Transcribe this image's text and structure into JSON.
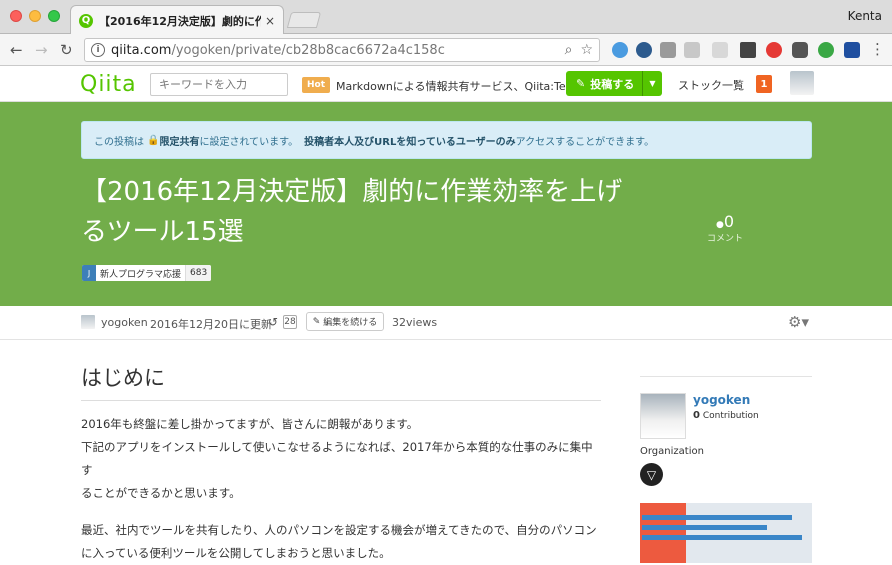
{
  "browser": {
    "tab_title": "【2016年12月決定版】劇的に作業",
    "tab_close": "×",
    "profile": "Kenta",
    "url_host": "qiita.com",
    "url_path": "/yogoken/private/cb28b8cac6672a4c158c"
  },
  "header": {
    "logo": "Qiita",
    "search_placeholder": "キーワードを入力",
    "hot_badge": "Hot",
    "hot_text": "Markdownによる情報共有サービス、Qiita:Team",
    "post_button": "投稿する",
    "stock_link": "ストック一覧",
    "notifications": "1"
  },
  "notice": {
    "pre": "この投稿は",
    "lock_scope": "限定共有",
    "mid": "に設定されています。",
    "emph": "投稿者本人及びURLを知っているユーザーのみ",
    "post": "アクセスすることができます。"
  },
  "article": {
    "title": "【2016年12月決定版】劇的に作業効率を上げるツール15選",
    "comment_count": "0",
    "comment_label": "コメント",
    "tag_name": "新人プログラマ応援",
    "tag_count": "683"
  },
  "meta": {
    "author": "yogoken",
    "updated": "2016年12月20日に更新",
    "revisions": "28",
    "edit_button": "編集を続ける",
    "views": "32views"
  },
  "body": {
    "heading": "はじめに",
    "para1_line1": "2016年も終盤に差し掛かってますが、皆さんに朗報があります。",
    "para1_line2": "下記のアプリをインストールして使いこなせるようになれば、2017年から本質的な仕事のみに集中す",
    "para1_line3": "ることができるかと思います。",
    "para2_line1": "最近、社内でツールを共有したり、人のパソコンを設定する機会が増えてきたので、自分のパソコン",
    "para2_line2": "に入っている便利ツールを公開してしまおうと思いました。"
  },
  "sidebar": {
    "username": "yogoken",
    "contribution_count": "0",
    "contribution_label": "Contribution",
    "organization_label": "Organization"
  },
  "colors": {
    "qiita_green": "#55c500",
    "hero_green": "#72ad4a",
    "notice_bg": "#d9edf7"
  }
}
